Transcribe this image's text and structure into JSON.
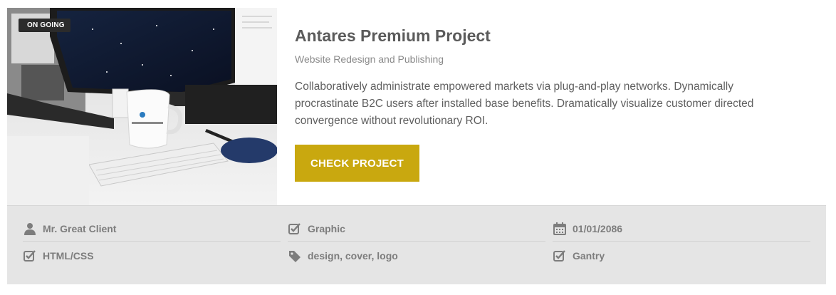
{
  "project": {
    "badge": "ON GOING",
    "title": "Antares Premium Project",
    "subtitle": "Website Redesign and Publishing",
    "description": "Collaboratively administrate empowered markets via plug-and-play networks. Dynamically procrastinate B2C users after installed base benefits. Dramatically visualize customer directed convergence without revolutionary ROI.",
    "button_label": "CHECK PROJECT"
  },
  "meta": {
    "client": "Mr. Great Client",
    "category": "Graphic",
    "date": "01/01/2086",
    "technology": "HTML/CSS",
    "tags": "design, cover, logo",
    "framework": "Gantry"
  },
  "icons": {
    "client": "user-icon",
    "category": "checkbox-icon",
    "date": "calendar-icon",
    "technology": "checkbox-icon",
    "tags": "tag-icon",
    "framework": "checkbox-icon"
  },
  "colors": {
    "accent": "#c9a80f",
    "meta_bg": "#e5e5e5",
    "title": "#5b5b5b",
    "badge_bg": "#2b2b2b"
  }
}
